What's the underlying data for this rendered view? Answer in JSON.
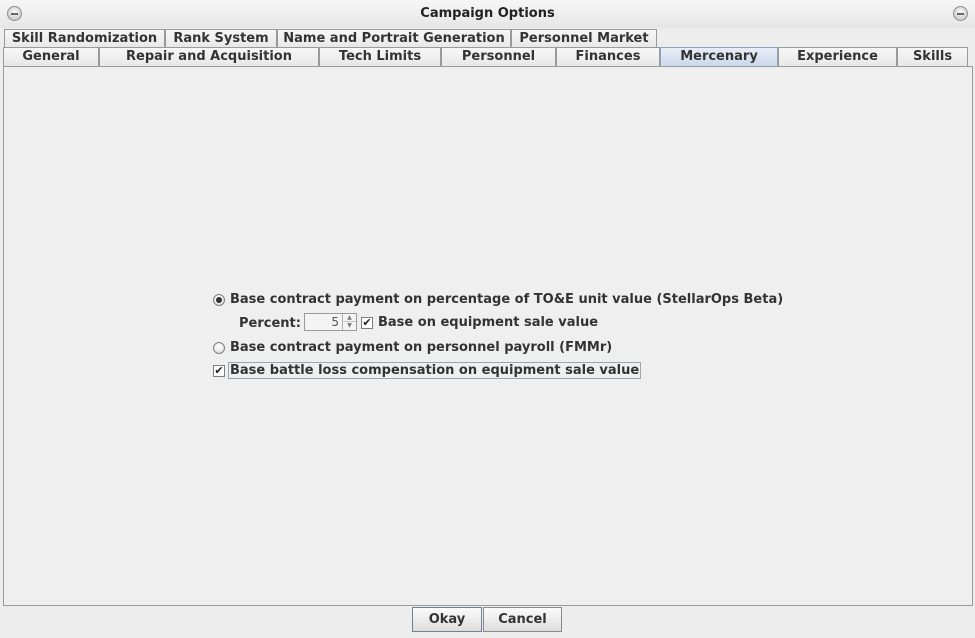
{
  "window": {
    "title": "Campaign Options",
    "menu_icon": "window-menu-icon",
    "close_icon": "window-close-icon"
  },
  "tabs": {
    "row1": [
      "Skill Randomization",
      "Rank System",
      "Name and Portrait Generation",
      "Personnel Market"
    ],
    "row2": [
      "General",
      "Repair and Acquisition",
      "Tech Limits",
      "Personnel",
      "Finances",
      "Mercenary",
      "Experience",
      "Skills"
    ],
    "selected": "Mercenary"
  },
  "mercenary": {
    "option_toe": {
      "label": "Base contract payment on percentage of TO&E unit value (StellarOps Beta)",
      "selected": true
    },
    "percent": {
      "label": "Percent:",
      "value": "5"
    },
    "equipment_sale": {
      "label": "Base on equipment sale value",
      "checked": true
    },
    "option_payroll": {
      "label": "Base contract payment on personnel payroll (FMMr)",
      "selected": false
    },
    "battle_loss": {
      "label": "Base battle loss compensation on equipment sale value",
      "checked": true
    }
  },
  "buttons": {
    "okay": "Okay",
    "cancel": "Cancel"
  }
}
